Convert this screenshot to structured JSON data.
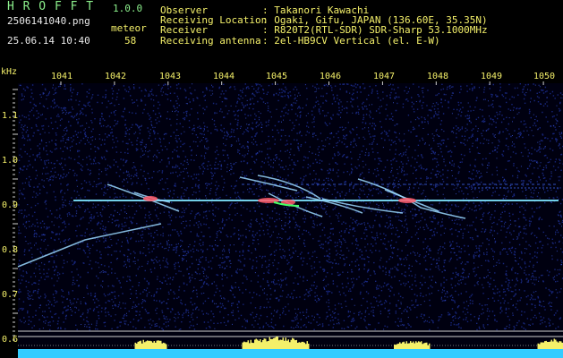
{
  "app": {
    "title": "H R O F F T",
    "version": "1.0.0",
    "filename": "2506141040.png",
    "datetime": "25.06.14 10:40",
    "meteor_label": "meteor",
    "meteor_count": "58"
  },
  "info": {
    "rows": [
      {
        "key": "Observer",
        "value": ": Takanori Kawachi"
      },
      {
        "key": "Receiving Location",
        "value": ": Ogaki, Gifu, JAPAN (136.60E, 35.35N)"
      },
      {
        "key": "Receiver",
        "value": ": R820T2(RTL-SDR) SDR-Sharp 53.1000MHz"
      },
      {
        "key": "Receiving antenna",
        "value": ": 2el-HB9CV Vertical (el. E-W)"
      }
    ]
  },
  "axes": {
    "y_unit": "kHz",
    "y_ticks": [
      "1.1",
      "1.0",
      "0.9",
      "0.8",
      "0.7",
      "0.6"
    ],
    "x_ticks": [
      "1041",
      "1042",
      "1043",
      "1044",
      "1045",
      "1046",
      "1047",
      "1048",
      "1049",
      "1050"
    ]
  },
  "colors": {
    "background": "#000000",
    "noise": "#1a2a8a",
    "carrier": "#7fe6ff",
    "echo": "#9ad8ff",
    "hot": "#ff5a6a",
    "level_bar": "#f4f06a",
    "baseline": "#33ccff"
  }
}
